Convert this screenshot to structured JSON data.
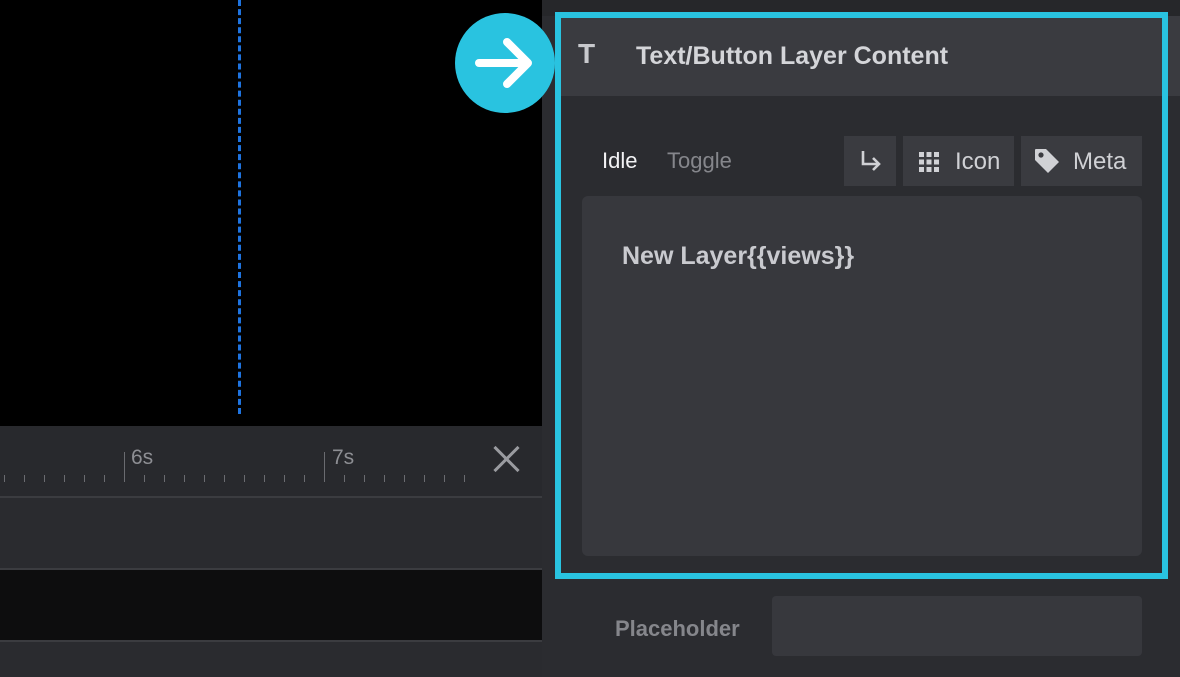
{
  "timeline": {
    "tick_labels": [
      "6s",
      "7s"
    ],
    "playhead_color": "#1f74e0"
  },
  "panel": {
    "section_title": "Text/Button Layer Content",
    "section_icon": "T",
    "tabs": [
      {
        "label": "Idle",
        "active": true
      },
      {
        "label": "Toggle",
        "active": false
      }
    ],
    "toolbar": {
      "enter_icon": "return-arrow-icon",
      "icon_label": "Icon",
      "meta_label": "Meta"
    },
    "content_text": "New Layer{{views}}",
    "placeholder_label": "Placeholder",
    "placeholder_value": ""
  },
  "colors": {
    "highlight": "#29c3e0",
    "panel_bg": "#2b2c30",
    "header_bg": "#3a3b40"
  }
}
